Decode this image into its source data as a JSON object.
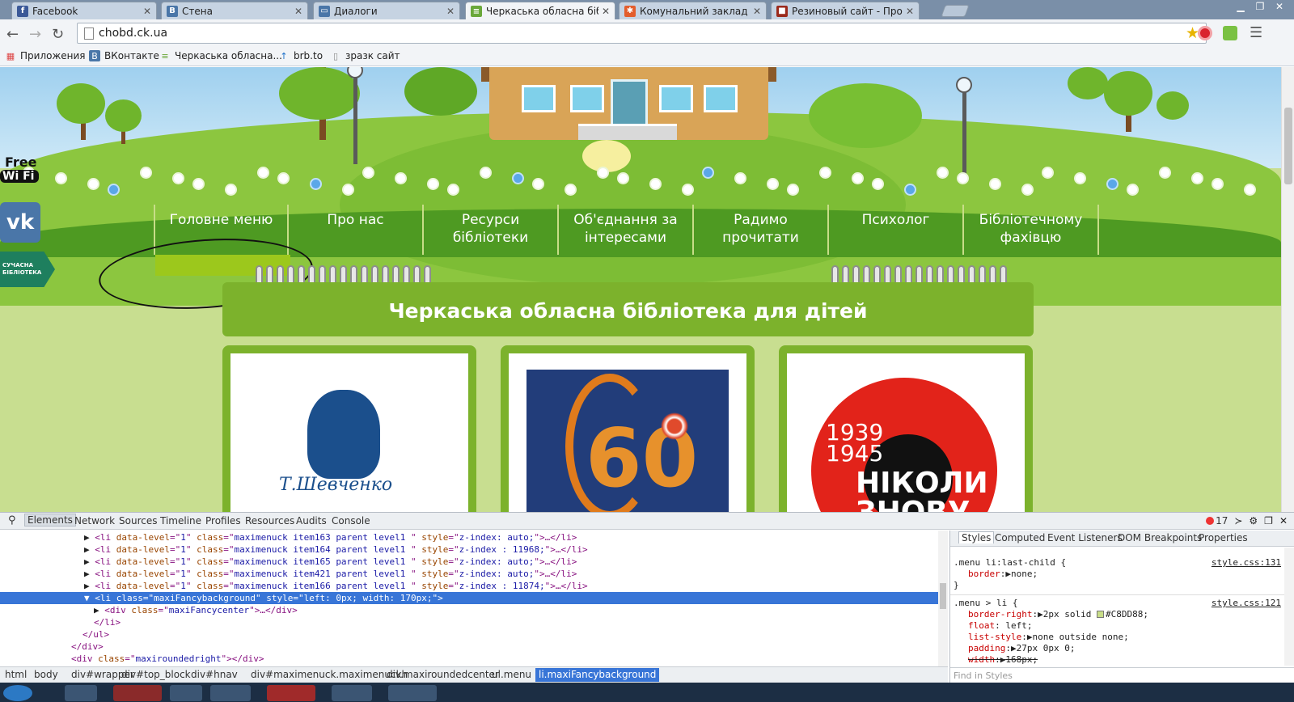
{
  "browser": {
    "tabs": [
      {
        "title": "Facebook",
        "icon": "facebook-icon",
        "color": "#3b5998",
        "glyph": "f"
      },
      {
        "title": "Стена",
        "icon": "vk-icon",
        "color": "#4a76a8",
        "glyph": "B"
      },
      {
        "title": "Диалоги",
        "icon": "vk-dialogs-icon",
        "color": "#4a76a8",
        "glyph": "▭"
      },
      {
        "title": "Черкаська обласна бібл",
        "icon": "books-icon",
        "color": "#6aa83a",
        "glyph": "≡"
      },
      {
        "title": "Комунальний заклад \"Об",
        "icon": "joomla-icon",
        "color": "#e35d2c",
        "glyph": "✱"
      },
      {
        "title": "Резиновый сайт - Пробл",
        "icon": "site-icon",
        "color": "#9b2a1c",
        "glyph": "■"
      }
    ],
    "url": "chobd.ck.ua",
    "bookmarks": [
      {
        "label": "Приложения",
        "icon": "apps-grid-icon"
      },
      {
        "label": "ВКонтакте",
        "icon": "vk-icon"
      },
      {
        "label": "Черкаська обласна...",
        "icon": "books-icon"
      },
      {
        "label": "brb.to",
        "icon": "arrow-up-icon"
      },
      {
        "label": "зразк сайт",
        "icon": "page-icon"
      }
    ]
  },
  "site": {
    "side_badges": [
      "Free",
      "Wi Fi",
      "СУЧАСНА БІБЛІОТЕКА"
    ],
    "menu": [
      "Головне меню",
      "Про нас",
      "Ресурси бібліотеки",
      "Об'єднання за інтересами",
      "Радимо прочитати",
      "Психолог",
      "Бібліотечному фахівцю"
    ],
    "title": "Черкаська обласна бібліотека для дітей",
    "cards": [
      {
        "caption": "Т.Шевченко"
      },
      {
        "caption": "60"
      },
      {
        "years_top": "1939",
        "years_bottom": "1945",
        "caption": "НІКОЛИ ЗНОВУ"
      }
    ]
  },
  "devtools": {
    "tabs": [
      "Elements",
      "Network",
      "Sources",
      "Timeline",
      "Profiles",
      "Resources",
      "Audits",
      "Console"
    ],
    "error_count": "17",
    "dom_lines": [
      {
        "indent": 104,
        "arrow": "▶",
        "html": [
          [
            "tag",
            "<li "
          ],
          [
            "an",
            "data-level"
          ],
          [
            "tag",
            "=\""
          ],
          [
            "av",
            "1"
          ],
          [
            "tag",
            "\" "
          ],
          [
            "an",
            "class"
          ],
          [
            "tag",
            "=\""
          ],
          [
            "av",
            "maximenuck item163 parent level1 "
          ],
          [
            "tag",
            "\" "
          ],
          [
            "an",
            "style"
          ],
          [
            "tag",
            "=\""
          ],
          [
            "av",
            "z-index: auto;"
          ],
          [
            "tag",
            "\">…</li>"
          ]
        ]
      },
      {
        "indent": 104,
        "arrow": "▶",
        "html": [
          [
            "tag",
            "<li "
          ],
          [
            "an",
            "data-level"
          ],
          [
            "tag",
            "=\""
          ],
          [
            "av",
            "1"
          ],
          [
            "tag",
            "\" "
          ],
          [
            "an",
            "class"
          ],
          [
            "tag",
            "=\""
          ],
          [
            "av",
            "maximenuck item164 parent level1 "
          ],
          [
            "tag",
            "\" "
          ],
          [
            "an",
            "style"
          ],
          [
            "tag",
            "=\""
          ],
          [
            "av",
            "z-index : 11968;"
          ],
          [
            "tag",
            "\">…</li>"
          ]
        ]
      },
      {
        "indent": 104,
        "arrow": "▶",
        "html": [
          [
            "tag",
            "<li "
          ],
          [
            "an",
            "data-level"
          ],
          [
            "tag",
            "=\""
          ],
          [
            "av",
            "1"
          ],
          [
            "tag",
            "\" "
          ],
          [
            "an",
            "class"
          ],
          [
            "tag",
            "=\""
          ],
          [
            "av",
            "maximenuck item165 parent level1 "
          ],
          [
            "tag",
            "\" "
          ],
          [
            "an",
            "style"
          ],
          [
            "tag",
            "=\""
          ],
          [
            "av",
            "z-index: auto;"
          ],
          [
            "tag",
            "\">…</li>"
          ]
        ]
      },
      {
        "indent": 104,
        "arrow": "▶",
        "html": [
          [
            "tag",
            "<li "
          ],
          [
            "an",
            "data-level"
          ],
          [
            "tag",
            "=\""
          ],
          [
            "av",
            "1"
          ],
          [
            "tag",
            "\" "
          ],
          [
            "an",
            "class"
          ],
          [
            "tag",
            "=\""
          ],
          [
            "av",
            "maximenuck item421 parent level1 "
          ],
          [
            "tag",
            "\" "
          ],
          [
            "an",
            "style"
          ],
          [
            "tag",
            "=\""
          ],
          [
            "av",
            "z-index: auto;"
          ],
          [
            "tag",
            "\">…</li>"
          ]
        ]
      },
      {
        "indent": 104,
        "arrow": "▶",
        "html": [
          [
            "tag",
            "<li "
          ],
          [
            "an",
            "data-level"
          ],
          [
            "tag",
            "=\""
          ],
          [
            "av",
            "1"
          ],
          [
            "tag",
            "\" "
          ],
          [
            "an",
            "class"
          ],
          [
            "tag",
            "=\""
          ],
          [
            "av",
            "maximenuck item166 parent level1 "
          ],
          [
            "tag",
            "\" "
          ],
          [
            "an",
            "style"
          ],
          [
            "tag",
            "=\""
          ],
          [
            "av",
            "z-index : 11874;"
          ],
          [
            "tag",
            "\">…</li>"
          ]
        ]
      },
      {
        "indent": 104,
        "arrow": "▼",
        "selected": true,
        "html": [
          [
            "tag",
            "<li "
          ],
          [
            "an",
            "class"
          ],
          [
            "tag",
            "=\""
          ],
          [
            "av",
            "maxiFancybackground"
          ],
          [
            "tag",
            "\" "
          ],
          [
            "an",
            "style"
          ],
          [
            "tag",
            "=\""
          ],
          [
            "av",
            "left: 0px; width: 170px;"
          ],
          [
            "tag",
            "\">"
          ]
        ]
      },
      {
        "indent": 116,
        "arrow": "▶",
        "html": [
          [
            "tag",
            "<div "
          ],
          [
            "an",
            "class"
          ],
          [
            "tag",
            "=\""
          ],
          [
            "av",
            "maxiFancycenter"
          ],
          [
            "tag",
            "\">…</div>"
          ]
        ]
      },
      {
        "indent": 116,
        "arrow": "",
        "html": [
          [
            "tag",
            "</li>"
          ]
        ]
      },
      {
        "indent": 102,
        "arrow": "",
        "html": [
          [
            "tag",
            "</ul>"
          ]
        ]
      },
      {
        "indent": 88,
        "arrow": "",
        "html": [
          [
            "tag",
            "</div>"
          ]
        ]
      },
      {
        "indent": 88,
        "arrow": "",
        "html": [
          [
            "tag",
            "<div "
          ],
          [
            "an",
            "class"
          ],
          [
            "tag",
            "=\""
          ],
          [
            "av",
            "maxiroundedright"
          ],
          [
            "tag",
            "\"></div>"
          ]
        ]
      }
    ],
    "breadcrumbs": [
      "html",
      "body",
      "div#wrapper",
      "div#top_block",
      "div#hnav",
      "div#maximenuck.maximenuckh",
      "div.maxiroundedcenter",
      "ul.menu",
      "li.maxiFancybackground"
    ],
    "style_tabs": [
      "Styles",
      "Computed",
      "Event Listeners",
      "DOM Breakpoints",
      "Properties"
    ],
    "rules": [
      {
        "selector": ".menu li:last-child {",
        "source": "style.css:131",
        "props": [
          {
            "name": "border",
            "value": "none;"
          }
        ]
      },
      {
        "selector": ".menu > li {",
        "source": "style.css:121",
        "props": [
          {
            "name": "border-right",
            "value": "2px solid",
            "swatch": "#C8DD88;"
          },
          {
            "name": "float",
            "value": "left;"
          },
          {
            "name": "list-style",
            "value": "none outside none;"
          },
          {
            "name": "padding",
            "value": "27px 0px 0;"
          },
          {
            "name": "width",
            "value": "168px;",
            "struck": true
          }
        ]
      }
    ],
    "find_placeholder": "Find in Styles"
  }
}
